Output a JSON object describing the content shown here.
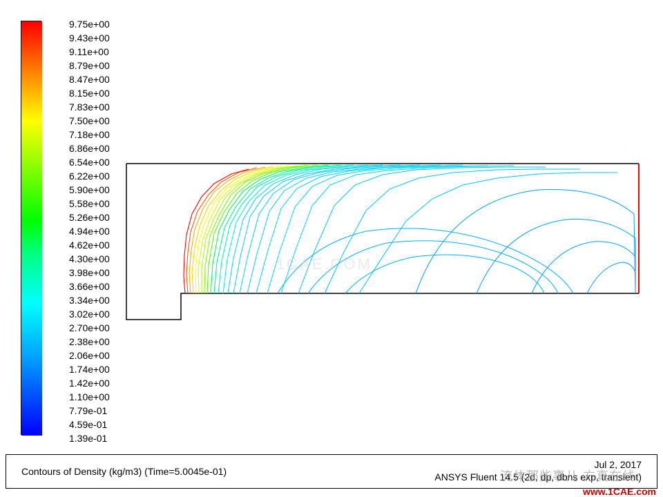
{
  "legend": {
    "values": [
      "9.75e+00",
      "9.43e+00",
      "9.11e+00",
      "8.79e+00",
      "8.47e+00",
      "8.15e+00",
      "7.83e+00",
      "7.50e+00",
      "7.18e+00",
      "6.86e+00",
      "6.54e+00",
      "6.22e+00",
      "5.90e+00",
      "5.58e+00",
      "5.26e+00",
      "4.94e+00",
      "4.62e+00",
      "4.30e+00",
      "3.98e+00",
      "3.66e+00",
      "3.34e+00",
      "3.02e+00",
      "2.70e+00",
      "2.38e+00",
      "2.06e+00",
      "1.74e+00",
      "1.42e+00",
      "1.10e+00",
      "7.79e-01",
      "4.59e-01",
      "1.39e-01"
    ],
    "colors": [
      "#ff0000",
      "#ff2a00",
      "#ff5500",
      "#ff7f00",
      "#ffaa00",
      "#ffd400",
      "#ffff00",
      "#d4ff00",
      "#aaff00",
      "#7fff00",
      "#55ff00",
      "#2aff00",
      "#00ff00",
      "#00ff2a",
      "#00ff55",
      "#00ff7f",
      "#00ffaa",
      "#00ffd4",
      "#00ffff",
      "#00d4ff",
      "#00aaff",
      "#007fff",
      "#0055ff",
      "#002aff",
      "#0000ff"
    ]
  },
  "footer": {
    "title": "Contours of Density (kg/m3)  (Time=5.0045e-01)",
    "date": "Jul 2, 2017",
    "software": "ANSYS Fluent 14.5 (2d, dp, dbns exp, transient)"
  },
  "watermark": {
    "center": "1CAE.COM",
    "cn": "流体那些事儿 方真在线",
    "url": "www.1CAE.com"
  }
}
